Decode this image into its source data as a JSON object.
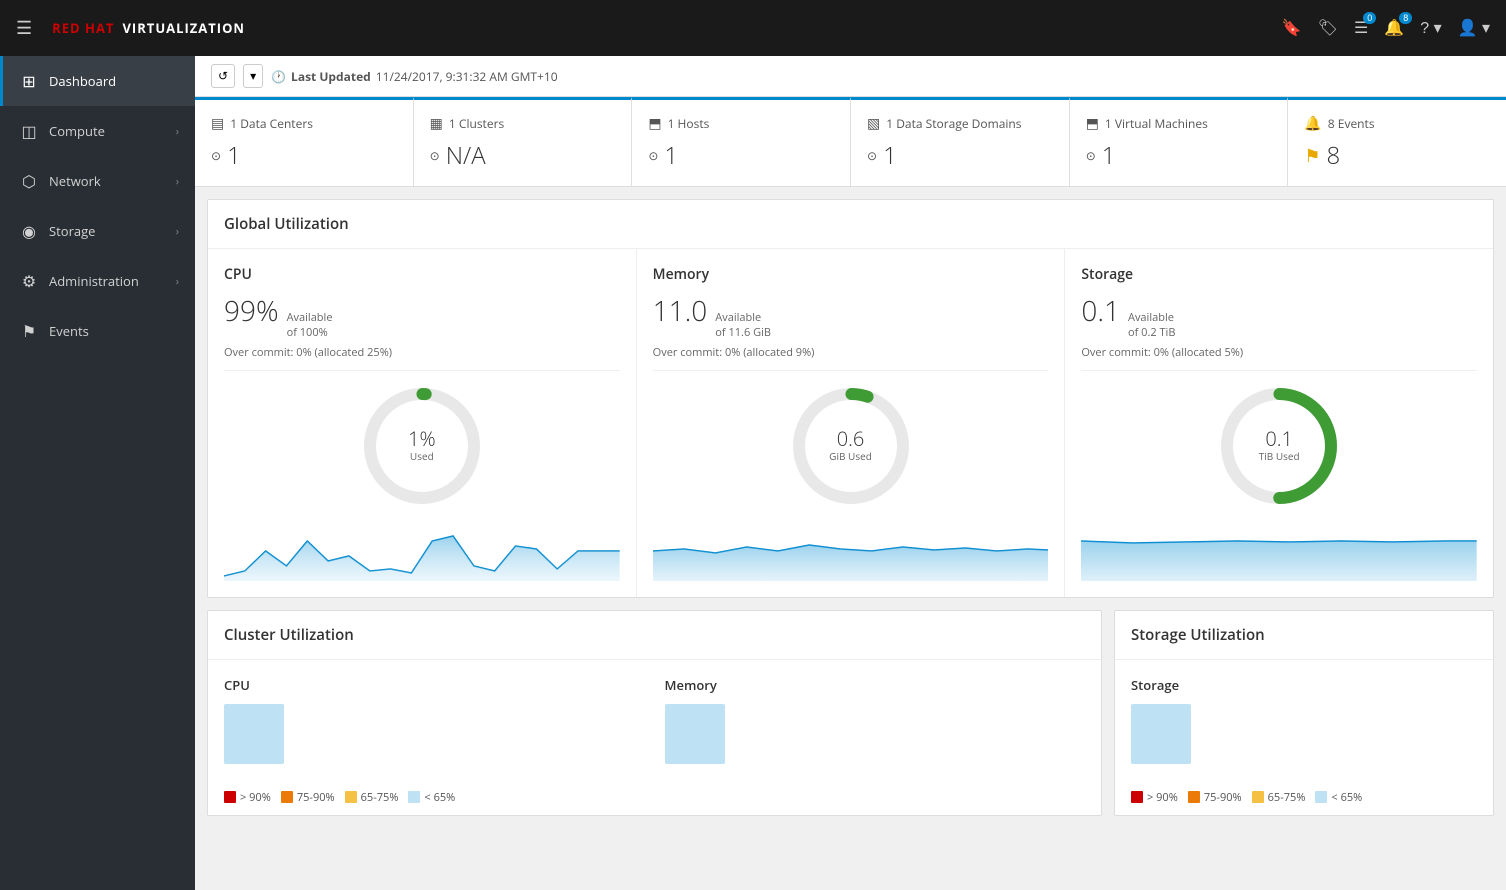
{
  "navbar": {
    "hamburger_label": "☰",
    "brand_red": "RED HAT",
    "brand_rest": "VIRTUALIZATION",
    "icons": {
      "bookmark": "🔖",
      "tag": "🏷",
      "list": "☰",
      "bell": "🔔",
      "help": "?",
      "user": "👤"
    },
    "list_badge": "0",
    "bell_badge": "8"
  },
  "sidebar": {
    "items": [
      {
        "id": "dashboard",
        "label": "Dashboard",
        "icon": "⊞",
        "active": true,
        "has_arrow": false
      },
      {
        "id": "compute",
        "label": "Compute",
        "icon": "⬡",
        "active": false,
        "has_arrow": true
      },
      {
        "id": "network",
        "label": "Network",
        "icon": "⬡",
        "active": false,
        "has_arrow": true
      },
      {
        "id": "storage",
        "label": "Storage",
        "icon": "⬡",
        "active": false,
        "has_arrow": true
      },
      {
        "id": "administration",
        "label": "Administration",
        "icon": "⚙",
        "active": false,
        "has_arrow": true
      },
      {
        "id": "events",
        "label": "Events",
        "icon": "⚑",
        "active": false,
        "has_arrow": false
      }
    ]
  },
  "toolbar": {
    "refresh_label": "↺",
    "dropdown_label": "▾",
    "last_updated_prefix": "Last Updated",
    "last_updated_value": "11/24/2017, 9:31:32 AM GMT+10"
  },
  "summary_cards": [
    {
      "id": "data-centers",
      "icon": "▤",
      "title": "1 Data Centers",
      "eye_icon": "⊙",
      "count": "1",
      "flag": false
    },
    {
      "id": "clusters",
      "icon": "▦",
      "title": "1 Clusters",
      "eye_icon": "⊙",
      "count": "N/A",
      "flag": false
    },
    {
      "id": "hosts",
      "icon": "⬒",
      "title": "1 Hosts",
      "eye_icon": "⊙",
      "count": "1",
      "flag": false
    },
    {
      "id": "data-storage",
      "icon": "▧",
      "title": "1 Data Storage Domains",
      "eye_icon": "⊙",
      "count": "1",
      "flag": false
    },
    {
      "id": "virtual-machines",
      "icon": "⬒",
      "title": "1 Virtual Machines",
      "eye_icon": "⊙",
      "count": "1",
      "flag": false
    },
    {
      "id": "events",
      "icon": "🔔",
      "title": "8 Events",
      "eye_icon": "",
      "count": "8",
      "flag": true
    }
  ],
  "global_utilization": {
    "title": "Global Utilization",
    "sections": [
      {
        "id": "cpu",
        "label": "CPU",
        "big_val": "99%",
        "small_line1": "Available",
        "small_line2": "of 100%",
        "overcommit": "Over commit: 0% (allocated 25%)",
        "donut_val": "1%",
        "donut_sub": "Used",
        "donut_percent": 1,
        "donut_color": "#3f9c35"
      },
      {
        "id": "memory",
        "label": "Memory",
        "big_val": "11.0",
        "small_line1": "Available",
        "small_line2": "of 11.6 GiB",
        "overcommit": "Over commit: 0% (allocated 9%)",
        "donut_val": "0.6",
        "donut_sub": "GiB Used",
        "donut_percent": 5,
        "donut_color": "#3f9c35"
      },
      {
        "id": "storage",
        "label": "Storage",
        "big_val": "0.1",
        "small_line1": "Available",
        "small_line2": "of 0.2 TiB",
        "overcommit": "Over commit: 0% (allocated 5%)",
        "donut_val": "0.1",
        "donut_sub": "TiB Used",
        "donut_percent": 50,
        "donut_color": "#3f9c35"
      }
    ]
  },
  "cluster_utilization": {
    "title": "Cluster Utilization",
    "sections": [
      {
        "id": "cpu",
        "label": "CPU"
      },
      {
        "id": "memory",
        "label": "Memory"
      }
    ],
    "legend": [
      {
        "label": "> 90%",
        "color": "#cc0000"
      },
      {
        "label": "75-90%",
        "color": "#ec7a08"
      },
      {
        "label": "65-75%",
        "color": "#f4c145"
      },
      {
        "label": "< 65%",
        "color": "#bee1f4"
      }
    ]
  },
  "storage_utilization": {
    "title": "Storage Utilization",
    "section_label": "Storage",
    "legend": [
      {
        "label": "> 90%",
        "color": "#cc0000"
      },
      {
        "label": "75-90%",
        "color": "#ec7a08"
      },
      {
        "label": "65-75%",
        "color": "#f4c145"
      },
      {
        "label": "< 65%",
        "color": "#bee1f4"
      }
    ]
  }
}
